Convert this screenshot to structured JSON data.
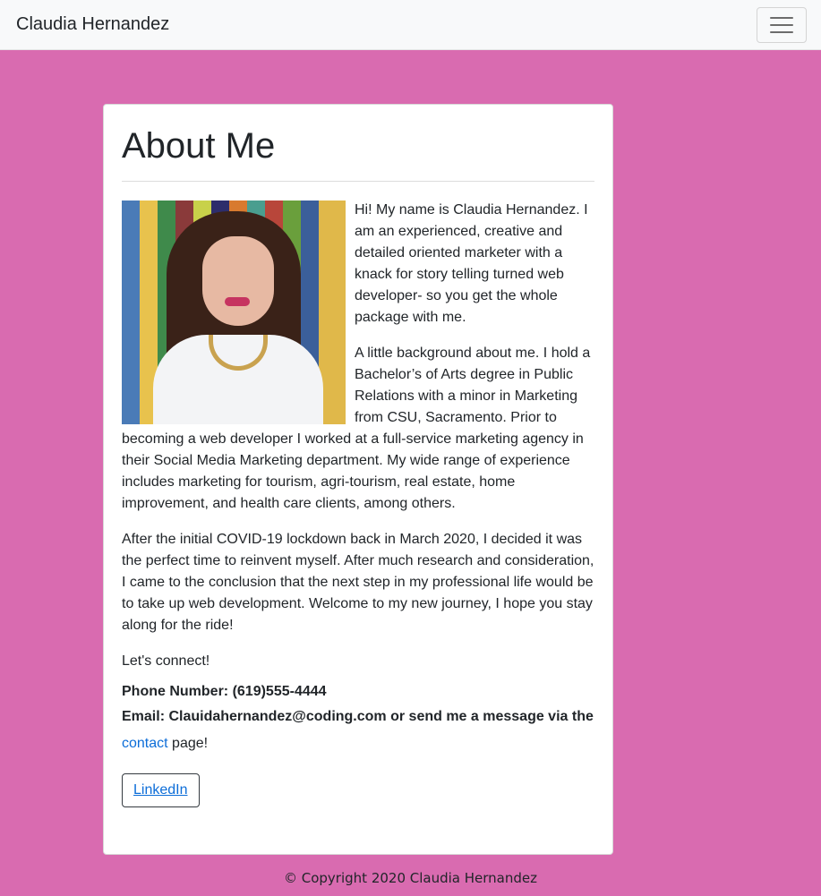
{
  "navbar": {
    "brand": "Claudia Hernandez",
    "toggler_icon": "hamburger-menu-icon"
  },
  "about": {
    "title": "About Me",
    "photo_alt": "Portrait of Claudia Hernandez",
    "paragraphs": [
      "Hi! My name is Claudia Hernandez. I am an experienced, creative and detailed oriented marketer with a knack for story telling turned web developer- so you get the whole package with me.",
      "A little background about me. I hold a Bachelor’s of Arts degree in Public Relations with a minor in Marketing from CSU, Sacramento. Prior to becoming a web developer I worked at a full-service marketing agency in their Social Media Marketing department. My wide range of experience includes marketing for tourism, agri-tourism, real estate, home improvement, and health care clients, among others.",
      "After the initial COVID-19 lockdown back in March 2020, I decided it was the perfect time to reinvent myself. After much research and consideration, I came to the conclusion that the next step in my professional life would be to take up web development. Welcome to my new journey, I hope you stay along for the ride!",
      "Let's connect!"
    ],
    "phone": "Phone Number: (619)555-4444",
    "email": "Email: Clauidahernandez@coding.com or send me a message via the",
    "contact_link": "contact",
    "contact_suffix": " page!",
    "linkedin_label": "LinkedIn"
  },
  "footer": {
    "copyright": "© Copyright 2020 Claudia Hernandez"
  },
  "colors": {
    "background": "#d96bb0",
    "link": "#0c6dd8"
  }
}
